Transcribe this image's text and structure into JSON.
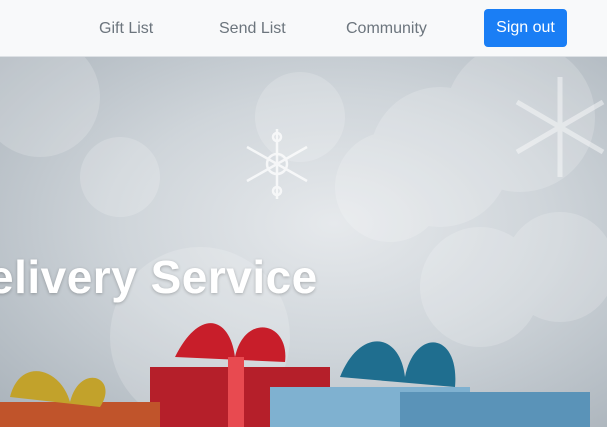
{
  "nav": {
    "links": [
      "Gift List",
      "Send List",
      "Community"
    ],
    "signout_label": "Sign out"
  },
  "hero": {
    "title": "elivery Service"
  },
  "colors": {
    "navbar_bg": "#f8f9fa",
    "nav_link": "#6c757d",
    "primary_button": "#1a7ef5",
    "hero_text": "#ffffff"
  },
  "icons": [
    "snowflake-icon",
    "gift-box-icon"
  ]
}
